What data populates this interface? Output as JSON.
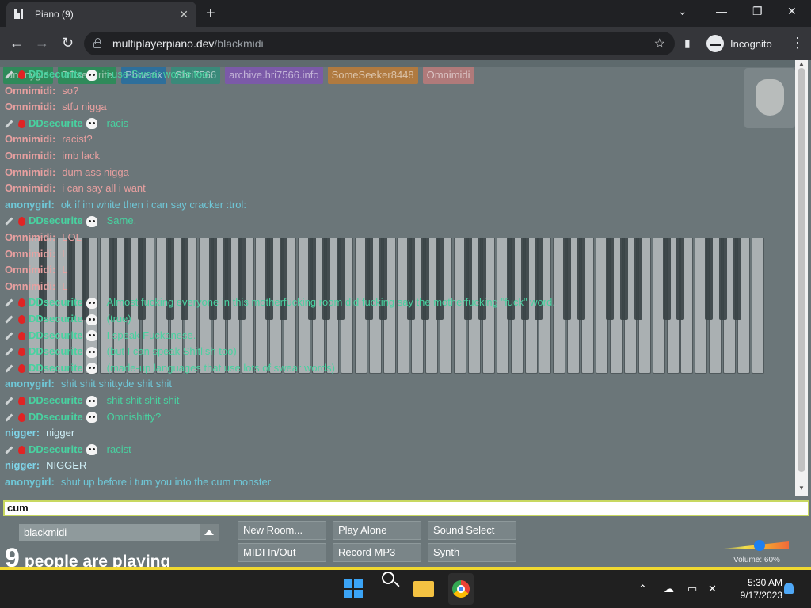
{
  "browser": {
    "tab_title": "Piano (9)",
    "tab_close": "✕",
    "new_tab": "+",
    "url_host": "multiplayerpiano.dev",
    "url_path": "/blackmidi",
    "incognito_label": "Incognito"
  },
  "userbar": [
    {
      "label": "anonygirl",
      "color": "#2f8a5a"
    },
    {
      "label": "DDsecurite",
      "color": "#2f8a5a"
    },
    {
      "label": "Phoenix",
      "color": "#2e6f9b"
    },
    {
      "label": "Shri7566",
      "color": "#3a8a7a"
    },
    {
      "label": "archive.hri7566.info",
      "color": "#7b5aa8"
    },
    {
      "label": "SomeSeeker8448",
      "color": "#b07a40"
    },
    {
      "label": "Omnimidi",
      "color": "#b07a7a"
    }
  ],
  "chat": [
    {
      "style": "tag-green",
      "decor": true,
      "nick": "DDsecurite",
      "text": "i use Swear words too"
    },
    {
      "style": "tag-pink",
      "decor": false,
      "nick": "Omnimidi:",
      "text": "so?"
    },
    {
      "style": "tag-pink",
      "decor": false,
      "nick": "Omnimidi:",
      "text": "stfu nigga"
    },
    {
      "style": "tag-green",
      "decor": true,
      "nick": "DDsecurite",
      "text": "racis"
    },
    {
      "style": "tag-pink",
      "decor": false,
      "nick": "Omnimidi:",
      "text": "racist?"
    },
    {
      "style": "tag-pink",
      "decor": false,
      "nick": "Omnimidi:",
      "text": "imb lack"
    },
    {
      "style": "tag-pink",
      "decor": false,
      "nick": "Omnimidi:",
      "text": "dum ass nigga"
    },
    {
      "style": "tag-pink",
      "decor": false,
      "nick": "Omnimidi:",
      "text": "i can say all i want"
    },
    {
      "style": "tag-cyan",
      "decor": false,
      "nick": "anonygirl:",
      "text": "ok if im white then i can say cracker :trol:"
    },
    {
      "style": "tag-green",
      "decor": true,
      "nick": "DDsecurite",
      "text": "Same."
    },
    {
      "style": "tag-pink",
      "decor": false,
      "nick": "Omnimidi:",
      "text": "LOL"
    },
    {
      "style": "tag-pink",
      "decor": false,
      "nick": "Omnimidi:",
      "text": "L"
    },
    {
      "style": "tag-pink",
      "decor": false,
      "nick": "Omnimidi:",
      "text": "L"
    },
    {
      "style": "tag-pink",
      "decor": false,
      "nick": "Omnimidi:",
      "text": "L"
    },
    {
      "style": "tag-green",
      "decor": true,
      "nick": "DDsecurite",
      "text": "Almost fucking everyone in this motherfucking room did fucking say the motherfucking \"fuck\" word."
    },
    {
      "style": "tag-green",
      "decor": true,
      "nick": "DDsecurite",
      "text": "(true)"
    },
    {
      "style": "tag-green",
      "decor": true,
      "nick": "DDsecurite",
      "text": "I speak Fuckanese."
    },
    {
      "style": "tag-green",
      "decor": true,
      "nick": "DDsecurite",
      "text": "(but I can speak Shitlish too)"
    },
    {
      "style": "tag-green",
      "decor": true,
      "nick": "DDsecurite",
      "text": "(made-up languages that use lots of swear words)"
    },
    {
      "style": "tag-cyan",
      "decor": false,
      "nick": "anonygirl:",
      "text": "shit shit shittyde shit shit"
    },
    {
      "style": "tag-green",
      "decor": true,
      "nick": "DDsecurite",
      "text": "shit shit shit shit"
    },
    {
      "style": "tag-green",
      "decor": true,
      "nick": "DDsecurite",
      "text": "Omnishitty?"
    },
    {
      "style": "tag-blue",
      "decor": false,
      "nick": "nigger:",
      "text": "nigger"
    },
    {
      "style": "tag-green",
      "decor": true,
      "nick": "DDsecurite",
      "text": "racist"
    },
    {
      "style": "tag-blue",
      "decor": false,
      "nick": "nigger:",
      "text": "NIGGER"
    },
    {
      "style": "tag-cyan",
      "decor": false,
      "nick": "anonygirl:",
      "text": "shut up before i turn you into the cum monster"
    }
  ],
  "chat_input_value": "cum",
  "room": {
    "name": "blackmidi",
    "player_count": "9",
    "players_label": "people are playing"
  },
  "buttons": {
    "new_room": "New Room...",
    "play_alone": "Play Alone",
    "sound_select": "Sound Select",
    "midi": "MIDI In/Out",
    "record": "Record MP3",
    "synth": "Synth"
  },
  "volume_label": "Volume: 60%",
  "volume_level": 0.6,
  "taskbar": {
    "time": "5:30 AM",
    "date": "9/17/2023"
  }
}
